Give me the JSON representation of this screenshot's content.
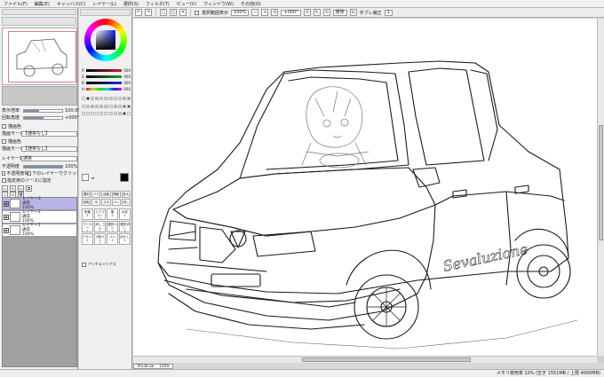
{
  "menubar": {
    "items": [
      "ファイル(F)",
      "編集(E)",
      "キャンバス(C)",
      "レイヤー(L)",
      "選択(S)",
      "フィルタ(T)",
      "ビュー(V)",
      "ウィンドウ(W)",
      "その他(O)"
    ]
  },
  "toolbar": {
    "stabilizer_toggle_label": "選択範囲表示",
    "zoom_value": "100%",
    "rotation_value": "+000°",
    "normal_label": "通常",
    "hand_correction_label": "手ブレ補正",
    "hand_correction_value": "1"
  },
  "left_panel": {
    "zoom_label": "表示倍率",
    "zoom_value": "100.0%",
    "angle_label": "回転角度",
    "angle_value": "+000°",
    "layer_color_label": "描画色",
    "mode_label": "描画モード",
    "mode_value": "【通常なし】",
    "color_mode_label": "描画色",
    "color_mode_value": "【通常なし】",
    "effect_label": "レイヤー効果",
    "blend_label": "合成モード",
    "blend_value": "通常",
    "opacity_label": "不透明度",
    "opacity_value": "100%",
    "protect_opacity_label": "不透明度保護",
    "clipping_label": "下のレイヤーでクリッピング",
    "select_source_label": "指定用のソースに指定",
    "layers": [
      {
        "name": "レイヤー3",
        "mode": "通常",
        "opacity": "100%",
        "selected": true
      },
      {
        "name": "レイヤー2",
        "mode": "通常",
        "opacity": "100%",
        "selected": false
      },
      {
        "name": "レイヤー1",
        "mode": "通常",
        "opacity": "100%",
        "selected": false
      }
    ]
  },
  "color_panel": {
    "bars": [
      {
        "label": "R",
        "value": "000",
        "color": "#d02020"
      },
      {
        "label": "G",
        "value": "000",
        "color": "#20a020"
      },
      {
        "label": "B",
        "value": "000",
        "color": "#2030d0"
      },
      {
        "label": "H",
        "value": "000",
        "color": "#9a6fc0"
      },
      {
        "label": "S",
        "value": "000",
        "color": "#8aa0c0"
      },
      {
        "label": "V",
        "value": "000",
        "color": "#404040"
      }
    ],
    "tools": [
      "選択",
      "ベクタ",
      "自動",
      "移動",
      "拡大",
      "回転",
      "手",
      "スポ",
      "ペン",
      "消し"
    ],
    "brushes": [
      {
        "name": "鉛筆",
        "size": "1"
      },
      {
        "name": "エアブラシ",
        "size": "1"
      },
      {
        "name": "筆",
        "size": "1"
      },
      {
        "name": "水彩",
        "size": "1"
      },
      {
        "name": "マーカー",
        "size": "1"
      },
      {
        "name": "消しゴム",
        "size": "1"
      },
      {
        "name": "選択ペン",
        "size": "1"
      },
      {
        "name": "選択消し",
        "size": "1"
      },
      {
        "name": "バケツ",
        "size": "1"
      },
      {
        "name": "2値ペン",
        "size": "1"
      },
      {
        "name": "ペン",
        "size": "1"
      },
      {
        "name": "ぼかし",
        "size": "1"
      }
    ],
    "antialias_label": "アンチエイリアス"
  },
  "canvas": {
    "tab_label": "TA338.sai",
    "tab_zoom": "100%"
  },
  "statusbar": {
    "text": "メモリ使用率 10% (空き 1551MB / 上限 4000MB)"
  }
}
